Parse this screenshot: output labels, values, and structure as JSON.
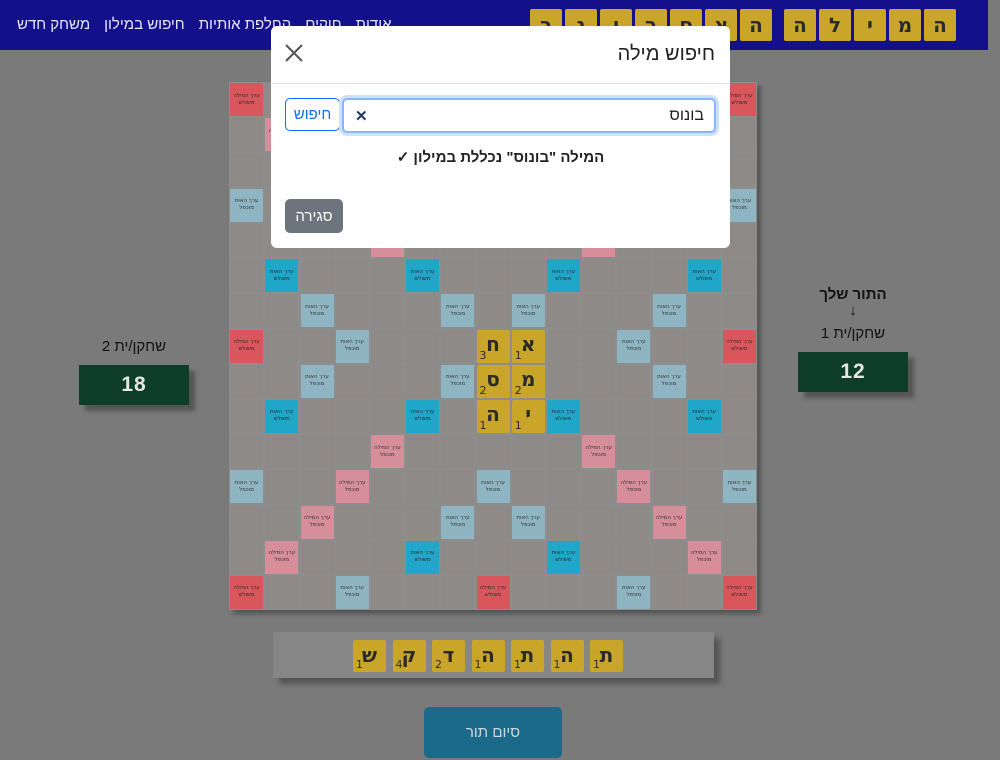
{
  "menu": {
    "items": [
      "אודות",
      "חוקים",
      "החלפת אותיות",
      "חיפוש במילון",
      "משחק חדש"
    ]
  },
  "logo": {
    "word1": [
      "ה",
      "מ",
      "י",
      "ל",
      "ה"
    ],
    "word2": [
      "ה",
      "א",
      "ס",
      "ר",
      "ו",
      "נ",
      "ר"
    ]
  },
  "player1": {
    "turn_label": "התור שלך",
    "turn_arrow": "↓",
    "name": "שחקן/ית 1",
    "score": "12"
  },
  "player2": {
    "name": "שחקן/ית 2",
    "score": "18"
  },
  "board": {
    "premium_labels": {
      "tw": "ערך המילה משולש",
      "dw": "ערך המילה מוכפל",
      "tl": "ערך האות משולש",
      "dl": "ערך האות מוכפל"
    },
    "colors": {
      "tw": "#d9565c",
      "dw": "#d58e9a",
      "tl": "#1fa6c8",
      "dl": "#8fb5c2",
      "normal": "#8e8a87",
      "tile": "#c9a629"
    },
    "tiles": [
      {
        "letter": "א",
        "value": "1"
      },
      {
        "letter": "מ",
        "value": "2"
      },
      {
        "letter": "י",
        "value": "1"
      },
      {
        "letter": "ח",
        "value": "3"
      },
      {
        "letter": "ס",
        "value": "2"
      },
      {
        "letter": "ה",
        "value": "1"
      }
    ]
  },
  "rack": [
    {
      "letter": "ת",
      "value": "1"
    },
    {
      "letter": "ה",
      "value": "1"
    },
    {
      "letter": "ת",
      "value": "1"
    },
    {
      "letter": "ה",
      "value": "1"
    },
    {
      "letter": "ד",
      "value": "2"
    },
    {
      "letter": "ק",
      "value": "4"
    },
    {
      "letter": "ש",
      "value": "1"
    }
  ],
  "end_turn_label": "סיום תור",
  "modal": {
    "title": "חיפוש מילה",
    "search_value": "בונוס",
    "search_button": "חיפוש",
    "clear_symbol": "✕",
    "result": "המילה \"בונוס\" נכללת במילון ✓",
    "close_button": "סגירה"
  }
}
